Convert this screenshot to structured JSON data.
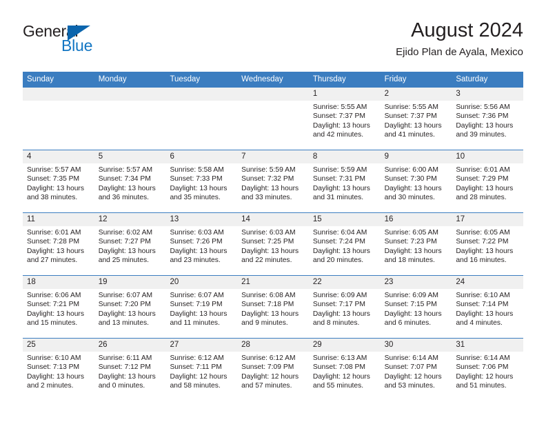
{
  "brand": {
    "name_top": "General",
    "name_bottom": "Blue",
    "color_top": "#231f20",
    "color_bottom": "#1376c3",
    "triangle_color": "#0b65ad"
  },
  "header": {
    "title": "August 2024",
    "subtitle": "Ejido Plan de Ayala, Mexico"
  },
  "theme": {
    "header_bg": "#3b7dc0",
    "header_text": "#ffffff",
    "daynum_band": "#f0f0f0",
    "cell_bg": "#ffffff",
    "text": "#231f20"
  },
  "calendar": {
    "weekdays": [
      "Sunday",
      "Monday",
      "Tuesday",
      "Wednesday",
      "Thursday",
      "Friday",
      "Saturday"
    ],
    "weeks": [
      [
        {
          "day": "",
          "sunrise": "",
          "sunset": "",
          "daylight_line1": "",
          "daylight_line2": ""
        },
        {
          "day": "",
          "sunrise": "",
          "sunset": "",
          "daylight_line1": "",
          "daylight_line2": ""
        },
        {
          "day": "",
          "sunrise": "",
          "sunset": "",
          "daylight_line1": "",
          "daylight_line2": ""
        },
        {
          "day": "",
          "sunrise": "",
          "sunset": "",
          "daylight_line1": "",
          "daylight_line2": ""
        },
        {
          "day": "1",
          "sunrise": "Sunrise: 5:55 AM",
          "sunset": "Sunset: 7:37 PM",
          "daylight_line1": "Daylight: 13 hours",
          "daylight_line2": "and 42 minutes."
        },
        {
          "day": "2",
          "sunrise": "Sunrise: 5:55 AM",
          "sunset": "Sunset: 7:37 PM",
          "daylight_line1": "Daylight: 13 hours",
          "daylight_line2": "and 41 minutes."
        },
        {
          "day": "3",
          "sunrise": "Sunrise: 5:56 AM",
          "sunset": "Sunset: 7:36 PM",
          "daylight_line1": "Daylight: 13 hours",
          "daylight_line2": "and 39 minutes."
        }
      ],
      [
        {
          "day": "4",
          "sunrise": "Sunrise: 5:57 AM",
          "sunset": "Sunset: 7:35 PM",
          "daylight_line1": "Daylight: 13 hours",
          "daylight_line2": "and 38 minutes."
        },
        {
          "day": "5",
          "sunrise": "Sunrise: 5:57 AM",
          "sunset": "Sunset: 7:34 PM",
          "daylight_line1": "Daylight: 13 hours",
          "daylight_line2": "and 36 minutes."
        },
        {
          "day": "6",
          "sunrise": "Sunrise: 5:58 AM",
          "sunset": "Sunset: 7:33 PM",
          "daylight_line1": "Daylight: 13 hours",
          "daylight_line2": "and 35 minutes."
        },
        {
          "day": "7",
          "sunrise": "Sunrise: 5:59 AM",
          "sunset": "Sunset: 7:32 PM",
          "daylight_line1": "Daylight: 13 hours",
          "daylight_line2": "and 33 minutes."
        },
        {
          "day": "8",
          "sunrise": "Sunrise: 5:59 AM",
          "sunset": "Sunset: 7:31 PM",
          "daylight_line1": "Daylight: 13 hours",
          "daylight_line2": "and 31 minutes."
        },
        {
          "day": "9",
          "sunrise": "Sunrise: 6:00 AM",
          "sunset": "Sunset: 7:30 PM",
          "daylight_line1": "Daylight: 13 hours",
          "daylight_line2": "and 30 minutes."
        },
        {
          "day": "10",
          "sunrise": "Sunrise: 6:01 AM",
          "sunset": "Sunset: 7:29 PM",
          "daylight_line1": "Daylight: 13 hours",
          "daylight_line2": "and 28 minutes."
        }
      ],
      [
        {
          "day": "11",
          "sunrise": "Sunrise: 6:01 AM",
          "sunset": "Sunset: 7:28 PM",
          "daylight_line1": "Daylight: 13 hours",
          "daylight_line2": "and 27 minutes."
        },
        {
          "day": "12",
          "sunrise": "Sunrise: 6:02 AM",
          "sunset": "Sunset: 7:27 PM",
          "daylight_line1": "Daylight: 13 hours",
          "daylight_line2": "and 25 minutes."
        },
        {
          "day": "13",
          "sunrise": "Sunrise: 6:03 AM",
          "sunset": "Sunset: 7:26 PM",
          "daylight_line1": "Daylight: 13 hours",
          "daylight_line2": "and 23 minutes."
        },
        {
          "day": "14",
          "sunrise": "Sunrise: 6:03 AM",
          "sunset": "Sunset: 7:25 PM",
          "daylight_line1": "Daylight: 13 hours",
          "daylight_line2": "and 22 minutes."
        },
        {
          "day": "15",
          "sunrise": "Sunrise: 6:04 AM",
          "sunset": "Sunset: 7:24 PM",
          "daylight_line1": "Daylight: 13 hours",
          "daylight_line2": "and 20 minutes."
        },
        {
          "day": "16",
          "sunrise": "Sunrise: 6:05 AM",
          "sunset": "Sunset: 7:23 PM",
          "daylight_line1": "Daylight: 13 hours",
          "daylight_line2": "and 18 minutes."
        },
        {
          "day": "17",
          "sunrise": "Sunrise: 6:05 AM",
          "sunset": "Sunset: 7:22 PM",
          "daylight_line1": "Daylight: 13 hours",
          "daylight_line2": "and 16 minutes."
        }
      ],
      [
        {
          "day": "18",
          "sunrise": "Sunrise: 6:06 AM",
          "sunset": "Sunset: 7:21 PM",
          "daylight_line1": "Daylight: 13 hours",
          "daylight_line2": "and 15 minutes."
        },
        {
          "day": "19",
          "sunrise": "Sunrise: 6:07 AM",
          "sunset": "Sunset: 7:20 PM",
          "daylight_line1": "Daylight: 13 hours",
          "daylight_line2": "and 13 minutes."
        },
        {
          "day": "20",
          "sunrise": "Sunrise: 6:07 AM",
          "sunset": "Sunset: 7:19 PM",
          "daylight_line1": "Daylight: 13 hours",
          "daylight_line2": "and 11 minutes."
        },
        {
          "day": "21",
          "sunrise": "Sunrise: 6:08 AM",
          "sunset": "Sunset: 7:18 PM",
          "daylight_line1": "Daylight: 13 hours",
          "daylight_line2": "and 9 minutes."
        },
        {
          "day": "22",
          "sunrise": "Sunrise: 6:09 AM",
          "sunset": "Sunset: 7:17 PM",
          "daylight_line1": "Daylight: 13 hours",
          "daylight_line2": "and 8 minutes."
        },
        {
          "day": "23",
          "sunrise": "Sunrise: 6:09 AM",
          "sunset": "Sunset: 7:15 PM",
          "daylight_line1": "Daylight: 13 hours",
          "daylight_line2": "and 6 minutes."
        },
        {
          "day": "24",
          "sunrise": "Sunrise: 6:10 AM",
          "sunset": "Sunset: 7:14 PM",
          "daylight_line1": "Daylight: 13 hours",
          "daylight_line2": "and 4 minutes."
        }
      ],
      [
        {
          "day": "25",
          "sunrise": "Sunrise: 6:10 AM",
          "sunset": "Sunset: 7:13 PM",
          "daylight_line1": "Daylight: 13 hours",
          "daylight_line2": "and 2 minutes."
        },
        {
          "day": "26",
          "sunrise": "Sunrise: 6:11 AM",
          "sunset": "Sunset: 7:12 PM",
          "daylight_line1": "Daylight: 13 hours",
          "daylight_line2": "and 0 minutes."
        },
        {
          "day": "27",
          "sunrise": "Sunrise: 6:12 AM",
          "sunset": "Sunset: 7:11 PM",
          "daylight_line1": "Daylight: 12 hours",
          "daylight_line2": "and 58 minutes."
        },
        {
          "day": "28",
          "sunrise": "Sunrise: 6:12 AM",
          "sunset": "Sunset: 7:09 PM",
          "daylight_line1": "Daylight: 12 hours",
          "daylight_line2": "and 57 minutes."
        },
        {
          "day": "29",
          "sunrise": "Sunrise: 6:13 AM",
          "sunset": "Sunset: 7:08 PM",
          "daylight_line1": "Daylight: 12 hours",
          "daylight_line2": "and 55 minutes."
        },
        {
          "day": "30",
          "sunrise": "Sunrise: 6:14 AM",
          "sunset": "Sunset: 7:07 PM",
          "daylight_line1": "Daylight: 12 hours",
          "daylight_line2": "and 53 minutes."
        },
        {
          "day": "31",
          "sunrise": "Sunrise: 6:14 AM",
          "sunset": "Sunset: 7:06 PM",
          "daylight_line1": "Daylight: 12 hours",
          "daylight_line2": "and 51 minutes."
        }
      ]
    ]
  }
}
